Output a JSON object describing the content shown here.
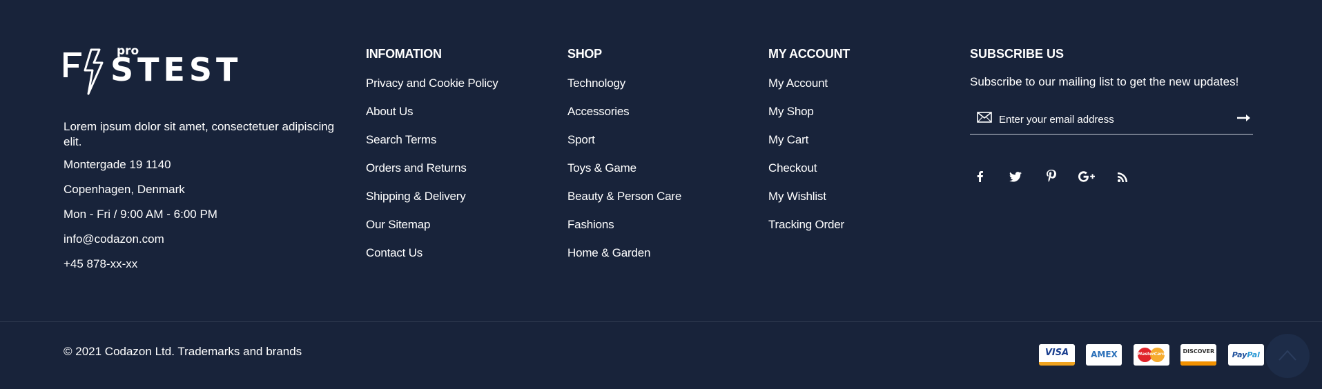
{
  "brand": {
    "logo_text": "FASTEST",
    "logo_superscript": "pro"
  },
  "about": {
    "description": "Lorem ipsum dolor sit amet, consectetuer adipiscing elit.",
    "address_line1": "Montergade 19 1140",
    "address_line2": "Copenhagen, Denmark",
    "hours": "Mon - Fri / 9:00 AM - 6:00 PM",
    "email": "info@codazon.com",
    "phone": "+45 878-xx-xx"
  },
  "columns": [
    {
      "title": "INFOMATION",
      "links": [
        "Privacy and Cookie Policy",
        "About Us",
        "Search Terms",
        "Orders and Returns",
        "Shipping & Delivery",
        "Our Sitemap",
        "Contact Us"
      ]
    },
    {
      "title": "SHOP",
      "links": [
        "Technology",
        "Accessories",
        "Sport",
        "Toys & Game",
        "Beauty & Person Care",
        "Fashions",
        "Home & Garden"
      ]
    },
    {
      "title": "MY ACCOUNT",
      "links": [
        "My Account",
        "My Shop",
        "My Cart",
        "Checkout",
        "My Wishlist",
        "Tracking Order"
      ]
    }
  ],
  "subscribe": {
    "title": "SUBSCRIBE US",
    "lead": "Subscribe to our mailing list to get the new updates!",
    "placeholder": "Enter your email address",
    "social_icons": [
      "facebook-icon",
      "twitter-icon",
      "pinterest-icon",
      "google-plus-icon",
      "rss-icon"
    ]
  },
  "copyright": "© 2021 Codazon Ltd. Trademarks and brands",
  "payments": {
    "visa": "VISA",
    "amex": "AMEX",
    "mastercard": "MasterCard",
    "discover": "DISCOVER",
    "paypal_a": "Pay",
    "paypal_b": "Pal"
  },
  "colors": {
    "background": "#18233a",
    "text": "#ffffff",
    "divider": "#2f3a50"
  }
}
